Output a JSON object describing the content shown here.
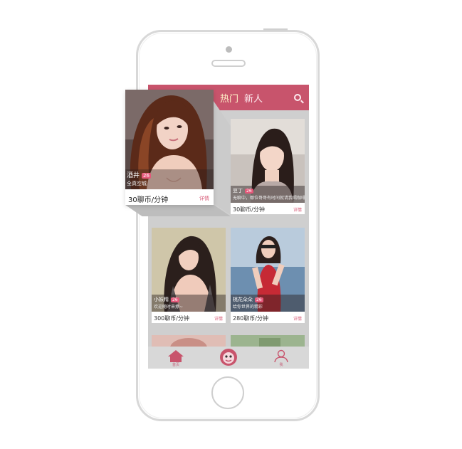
{
  "header": {
    "tabs": [
      {
        "label": "热门"
      },
      {
        "label": "新人"
      }
    ]
  },
  "profiles": [
    {
      "name": "酒井",
      "age": "26",
      "desc": "全真空城",
      "price": "30聊币/分钟",
      "detail": "详情"
    },
    {
      "name": "豆丁",
      "age": "26",
      "desc": "无聊中，哪位哥哥有时间就请我喝咖啡",
      "price": "30聊币/分钟",
      "detail": "详情"
    },
    {
      "name": "小妖精",
      "age": "26",
      "desc": "欢迎随时来撩~",
      "price": "300聊币/分钟",
      "detail": "详情"
    },
    {
      "name": "桃花朵朵",
      "age": "26",
      "desc": "给你世界的精彩",
      "price": "280聊币/分钟",
      "detail": "详情"
    }
  ],
  "bottom_nav": [
    {
      "label": "首页",
      "icon": "home-icon"
    },
    {
      "label": "",
      "icon": "mascot-icon"
    },
    {
      "label": "我",
      "icon": "user-icon"
    }
  ],
  "colors": {
    "accent": "#c8546c",
    "tab_active": "#fff3c9",
    "badge": "#e4597a"
  }
}
